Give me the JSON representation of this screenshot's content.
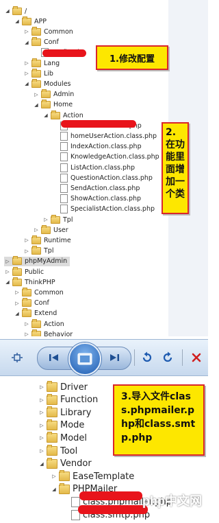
{
  "upper_tree": [
    {
      "label": "/",
      "depth": 0,
      "arrow": "down",
      "icon": "folder"
    },
    {
      "label": "APP",
      "depth": 1,
      "arrow": "down",
      "icon": "folder"
    },
    {
      "label": "Common",
      "depth": 2,
      "arrow": "right",
      "icon": "folder"
    },
    {
      "label": "Conf",
      "depth": 2,
      "arrow": "down",
      "icon": "folder"
    },
    {
      "label": "config.php",
      "depth": 3,
      "arrow": "",
      "icon": "file",
      "marked": true
    },
    {
      "label": "Lang",
      "depth": 2,
      "arrow": "right",
      "icon": "folder"
    },
    {
      "label": "Lib",
      "depth": 2,
      "arrow": "right",
      "icon": "folder"
    },
    {
      "label": "Modules",
      "depth": 2,
      "arrow": "down",
      "icon": "folder"
    },
    {
      "label": "Admin",
      "depth": 3,
      "arrow": "right",
      "icon": "folder"
    },
    {
      "label": "Home",
      "depth": 3,
      "arrow": "down",
      "icon": "folder"
    },
    {
      "label": "Action",
      "depth": 4,
      "arrow": "down",
      "icon": "folder"
    },
    {
      "label": "EmailAction.class.php",
      "depth": 5,
      "arrow": "",
      "icon": "file",
      "marked": true
    },
    {
      "label": "homeUserAction.class.php",
      "depth": 5,
      "arrow": "",
      "icon": "file"
    },
    {
      "label": "IndexAction.class.php",
      "depth": 5,
      "arrow": "",
      "icon": "file"
    },
    {
      "label": "KnowledgeAction.class.php",
      "depth": 5,
      "arrow": "",
      "icon": "file"
    },
    {
      "label": "ListAction.class.php",
      "depth": 5,
      "arrow": "",
      "icon": "file"
    },
    {
      "label": "QuestionAction.class.php",
      "depth": 5,
      "arrow": "",
      "icon": "file"
    },
    {
      "label": "SendAction.class.php",
      "depth": 5,
      "arrow": "",
      "icon": "file"
    },
    {
      "label": "ShowAction.class.php",
      "depth": 5,
      "arrow": "",
      "icon": "file"
    },
    {
      "label": "SpecialistAction.class.php",
      "depth": 5,
      "arrow": "",
      "icon": "file"
    },
    {
      "label": "Tpl",
      "depth": 4,
      "arrow": "right",
      "icon": "folder"
    },
    {
      "label": "User",
      "depth": 3,
      "arrow": "right",
      "icon": "folder"
    },
    {
      "label": "Runtime",
      "depth": 2,
      "arrow": "right",
      "icon": "folder"
    },
    {
      "label": "Tpl",
      "depth": 2,
      "arrow": "right",
      "icon": "folder"
    },
    {
      "label": "phpMyAdmin",
      "depth": 0,
      "arrow": "right",
      "icon": "folder",
      "selected": true
    },
    {
      "label": "Public",
      "depth": 0,
      "arrow": "right",
      "icon": "folder"
    },
    {
      "label": "ThinkPHP",
      "depth": 0,
      "arrow": "down",
      "icon": "folder"
    },
    {
      "label": "Common",
      "depth": 1,
      "arrow": "right",
      "icon": "folder"
    },
    {
      "label": "Conf",
      "depth": 1,
      "arrow": "right",
      "icon": "folder"
    },
    {
      "label": "Extend",
      "depth": 1,
      "arrow": "down",
      "icon": "folder"
    },
    {
      "label": "Action",
      "depth": 2,
      "arrow": "right",
      "icon": "folder"
    },
    {
      "label": "Behavior",
      "depth": 2,
      "arrow": "right",
      "icon": "folder"
    }
  ],
  "lower_tree": [
    {
      "label": "Driver",
      "depth": 0,
      "arrow": "right",
      "icon": "folder"
    },
    {
      "label": "Function",
      "depth": 0,
      "arrow": "right",
      "icon": "folder"
    },
    {
      "label": "Library",
      "depth": 0,
      "arrow": "right",
      "icon": "folder"
    },
    {
      "label": "Mode",
      "depth": 0,
      "arrow": "right",
      "icon": "folder"
    },
    {
      "label": "Model",
      "depth": 0,
      "arrow": "right",
      "icon": "folder"
    },
    {
      "label": "Tool",
      "depth": 0,
      "arrow": "right",
      "icon": "folder"
    },
    {
      "label": "Vendor",
      "depth": 0,
      "arrow": "down",
      "icon": "folder"
    },
    {
      "label": "EaseTemplate",
      "depth": 1,
      "arrow": "right",
      "icon": "folder"
    },
    {
      "label": "PHPMailer",
      "depth": 1,
      "arrow": "down",
      "icon": "folder"
    },
    {
      "label": "class.phpmailer.php",
      "depth": 2,
      "arrow": "",
      "icon": "file",
      "marked": true
    },
    {
      "label": "class.smtp.php",
      "depth": 2,
      "arrow": "",
      "icon": "file",
      "marked": true
    }
  ],
  "callouts": {
    "modify_config": "1.修改配置",
    "add_class": "2.在功能里面增加一个类",
    "import_files": "3.导入文件class.phpmailer.php和class.smtp.php"
  },
  "watermark": "php中文网",
  "toolbar": {
    "buttons": [
      "fit-view-icon",
      "previous-icon",
      "slideshow-icon",
      "next-icon",
      "rotate-left-icon",
      "rotate-right-icon",
      "delete-icon"
    ]
  },
  "colors": {
    "highlight_red": "#e8141b",
    "callout_fill": "#fde700",
    "callout_border": "#d9262a",
    "selected_bg": "#dcdcdc"
  }
}
